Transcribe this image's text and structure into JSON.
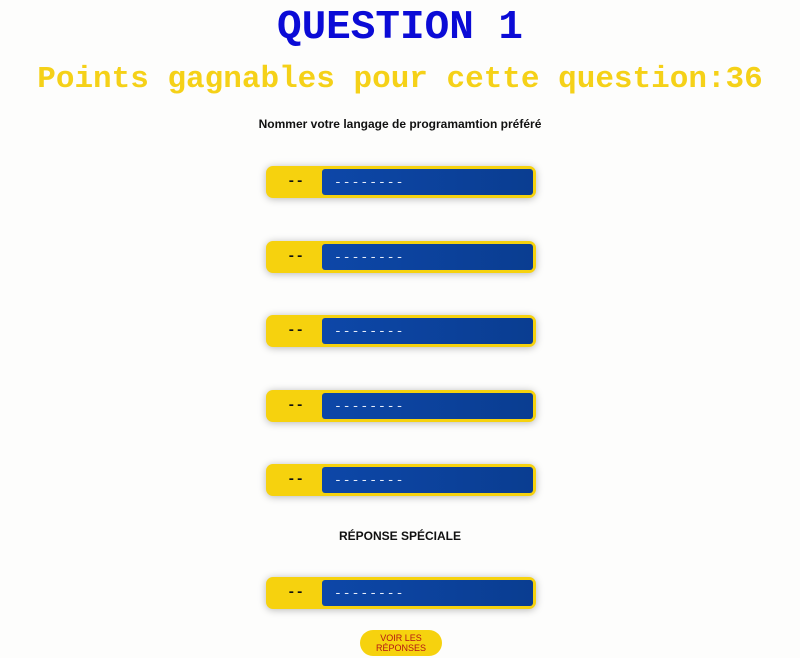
{
  "header": {
    "title": "QUESTION 1",
    "points_line": "Points gagnables pour cette question:36"
  },
  "question": {
    "prompt": "Nommer votre langage de programamtion préféré"
  },
  "answers": [
    {
      "points": "--",
      "text": "--------"
    },
    {
      "points": "--",
      "text": "--------"
    },
    {
      "points": "--",
      "text": "--------"
    },
    {
      "points": "--",
      "text": "--------"
    },
    {
      "points": "--",
      "text": "--------"
    }
  ],
  "special": {
    "label": "RÉPONSE SPÉCIALE",
    "answer": {
      "points": "--",
      "text": "--------"
    }
  },
  "reveal_button": {
    "label": "VOIR LES RÉPONSES"
  },
  "colors": {
    "title": "#0b0bd6",
    "points_line": "#f5d118",
    "answer_frame": "#f6d20e",
    "answer_bar": "#0d47a8",
    "button_text": "#b31515"
  }
}
